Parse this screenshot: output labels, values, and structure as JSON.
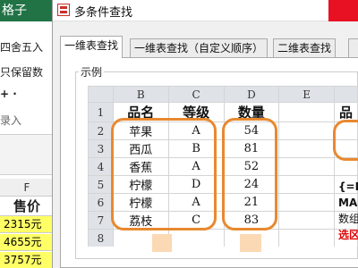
{
  "background_app": {
    "ribbon_tab": "格子",
    "row1": "四舍五入",
    "row2": "只保留数",
    "row3": "+ ·",
    "row4": "录入",
    "column_letter": "F",
    "header": "售价",
    "cells": [
      "2315元",
      "4655元",
      "3757元"
    ]
  },
  "dialog": {
    "title": "多条件查找",
    "tabs": [
      "一维表查找",
      "一维表查找（自定义顺序）",
      "二维表查找",
      ""
    ],
    "active_tab": 0,
    "group_label": "示例"
  },
  "sheet": {
    "columns": [
      "B",
      "C",
      "D",
      "E",
      ""
    ],
    "rows": [
      "1",
      "2",
      "3",
      "4",
      "5",
      "6",
      "7",
      "8"
    ],
    "headers": [
      "品名",
      "等级",
      "数量"
    ],
    "data": [
      [
        "苹果",
        "A",
        "54"
      ],
      [
        "西瓜",
        "B",
        "81"
      ],
      [
        "香蕉",
        "A",
        "52"
      ],
      [
        "柠檬",
        "D",
        "24"
      ],
      [
        "柠檬",
        "A",
        "21"
      ],
      [
        "荔枝",
        "C",
        "83"
      ]
    ],
    "side_text": [
      "{=I",
      "MA",
      "数组",
      "选区"
    ],
    "peek_header": "品"
  },
  "colors": {
    "highlight": "#e8892f",
    "title_close": "#e81123",
    "excel_green": "#217346",
    "yellow_fill": "#ffff66",
    "red_text": "#e00000"
  }
}
